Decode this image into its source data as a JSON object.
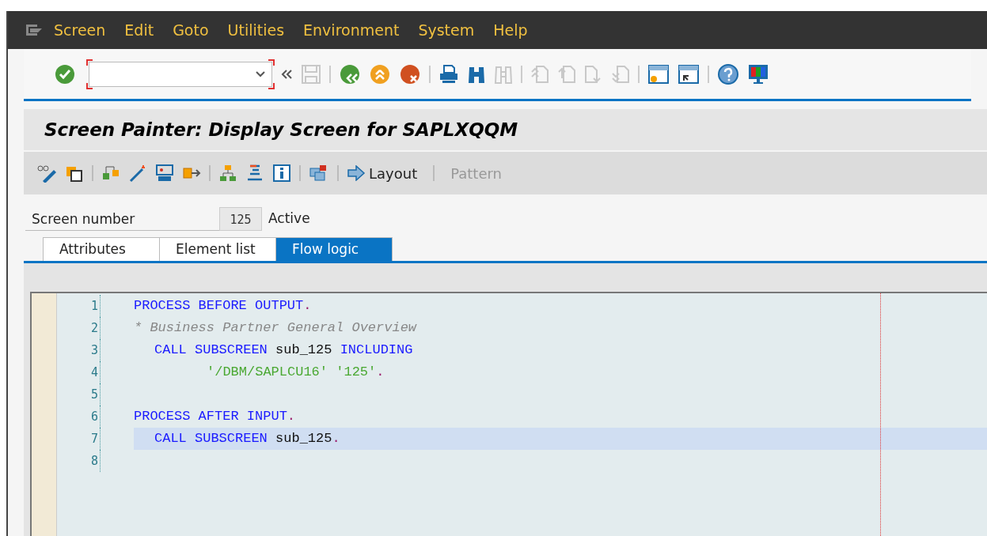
{
  "menu": [
    {
      "label": "Screen"
    },
    {
      "label": "Edit"
    },
    {
      "label": "Goto"
    },
    {
      "label": "Utilities"
    },
    {
      "label": "Environment"
    },
    {
      "label": "System"
    },
    {
      "label": "Help"
    }
  ],
  "title": "Screen Painter: Display Screen for SAPLXQQM",
  "app_toolbar": {
    "buttons": [
      {
        "label": "Layout",
        "disabled": false
      },
      {
        "label": "Pattern",
        "disabled": true
      }
    ]
  },
  "screen_number": {
    "label": "Screen number",
    "value": "125",
    "status": "Active"
  },
  "tabs": [
    {
      "label": "Attributes",
      "selected": false
    },
    {
      "label": "Element list",
      "selected": false
    },
    {
      "label": "Flow logic",
      "selected": true
    }
  ],
  "editor": {
    "lines": [
      {
        "number": "1",
        "kind": "top",
        "current": false,
        "tokens": [
          {
            "kind": "keyword",
            "text": "PROCESS BEFORE OUTPUT"
          },
          {
            "kind": "punct",
            "text": "."
          }
        ]
      },
      {
        "number": "2",
        "kind": "top",
        "current": false,
        "tokens": [
          {
            "kind": "comment",
            "text": "* Business Partner General Overview"
          }
        ]
      },
      {
        "number": "3",
        "kind": "nested",
        "current": false,
        "tokens": [
          {
            "kind": "keyword",
            "text": "CALL SUBSCREEN"
          },
          {
            "kind": "ident",
            "text": " sub_125 "
          },
          {
            "kind": "keyword",
            "text": "INCLUDING"
          }
        ]
      },
      {
        "number": "4",
        "kind": "continuation",
        "current": false,
        "tokens": [
          {
            "kind": "string",
            "text": "'/DBM/SAPLCU16' '125'"
          },
          {
            "kind": "punct",
            "text": "."
          }
        ]
      },
      {
        "number": "5",
        "kind": "blank",
        "current": false
      },
      {
        "number": "6",
        "kind": "top",
        "current": false,
        "tokens": [
          {
            "kind": "keyword",
            "text": "PROCESS AFTER INPUT"
          },
          {
            "kind": "punct",
            "text": "."
          }
        ]
      },
      {
        "number": "7",
        "kind": "nested",
        "current": true,
        "tokens": [
          {
            "kind": "keyword",
            "text": "CALL SUBSCREEN"
          },
          {
            "kind": "ident",
            "text": " sub_125"
          },
          {
            "kind": "punct",
            "text": "."
          }
        ]
      },
      {
        "number": "8",
        "kind": "blank",
        "current": false
      }
    ]
  }
}
